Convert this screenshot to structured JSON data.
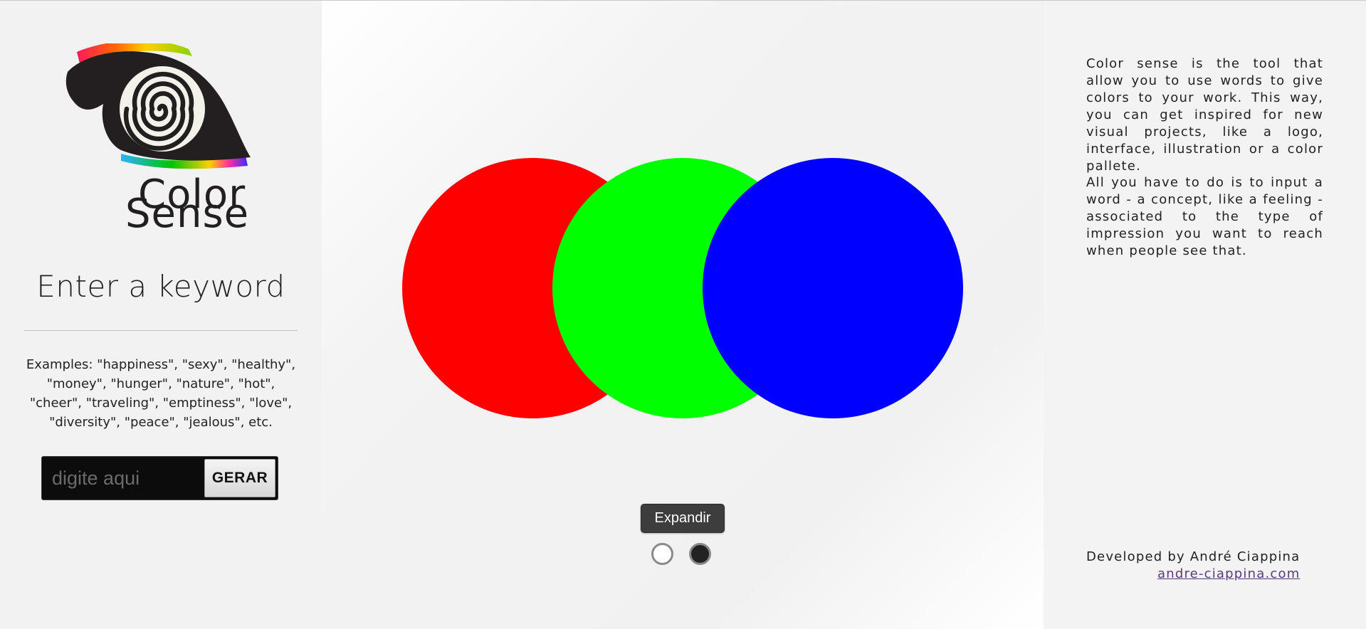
{
  "app": {
    "wordmark_line1": "Color",
    "wordmark_line2": "Sense"
  },
  "left": {
    "heading": "Enter a keyword",
    "examples": "Examples: \"happiness\", \"sexy\", \"healthy\", \"money\", \"hunger\", \"nature\", \"hot\", \"cheer\", \"traveling\", \"emptiness\", \"love\", \"diversity\", \"peace\", \"jealous\", etc.",
    "search": {
      "placeholder": "digite aqui",
      "value": "",
      "button_label": "GERAR"
    }
  },
  "palette": {
    "colors": [
      "#ff0000",
      "#00ff00",
      "#0000ff"
    ],
    "expand_label": "Expandir",
    "background_options": [
      "white",
      "dark"
    ]
  },
  "right": {
    "description_1": "Color sense is the tool that allow you to use words to give colors to your work. This way, you can get inspired for new visual projects, like a logo, interface, illustration or a color pallete.",
    "description_2": "All you have to do is to input a word - a concept, like a feeling - associated to the type of impression you want to reach when people see that.",
    "credit": "Developed by André Ciappina",
    "link": "andre-ciappina.com"
  },
  "icons": {
    "logo": "spiral-eye-logo"
  }
}
